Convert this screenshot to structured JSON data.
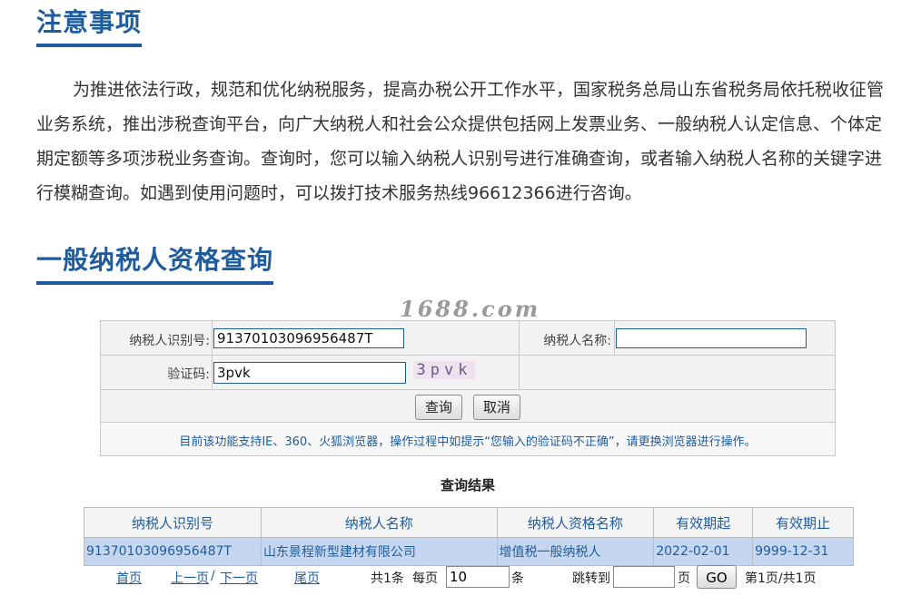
{
  "notice": {
    "title": "注意事项",
    "body": "为推进依法行政，规范和优化纳税服务，提高办税公开工作水平，国家税务总局山东省税务局依托税收征管业务系统，推出涉税查询平台，向广大纳税人和社会公众提供包括网上发票业务、一般纳税人认定信息、个体定期定额等多项涉税业务查询。查询时，您可以输入纳税人识别号进行准确查询，或者输入纳税人名称的关键字进行模糊查询。如遇到使用问题时，可以拨打技术服务热线96612366进行咨询。"
  },
  "query": {
    "title": "一般纳税人资格查询",
    "watermark": "1688.com",
    "taxpayer_id_label": "纳税人识别号:",
    "taxpayer_id_value": "91370103096956487T",
    "taxpayer_name_label": "纳税人名称:",
    "taxpayer_name_value": "",
    "captcha_label": "验证码:",
    "captcha_value": "3pvk",
    "captcha_image_text": "3pvk",
    "query_button": "查询",
    "cancel_button": "取消",
    "tip": "目前该功能支持IE、360、火狐浏览器，操作过程中如提示“您输入的验证码不正确”，请更换浏览器进行操作。"
  },
  "results": {
    "title": "查询结果",
    "columns": [
      "纳税人识别号",
      "纳税人名称",
      "纳税人资格名称",
      "有效期起",
      "有效期止"
    ],
    "rows": [
      [
        "91370103096956487T",
        "山东景程新型建材有限公司",
        "增值税一般纳税人",
        "2022-02-01",
        "9999-12-31"
      ]
    ]
  },
  "pager": {
    "first": "首页",
    "prev": "上一页",
    "sep": "/",
    "next": "下一页",
    "last": "尾页",
    "total": "共1条",
    "per_page_label": "每页",
    "per_page_value": "10",
    "per_page_unit": "条",
    "jump_label": "跳转到",
    "jump_value": "",
    "page_unit": "页",
    "go": "GO",
    "status": "第1页/共1页"
  },
  "colors": {
    "accent": "#1f5c9e",
    "row_highlight": "#c5d7f0",
    "form_bg": "#f2f2f2"
  }
}
